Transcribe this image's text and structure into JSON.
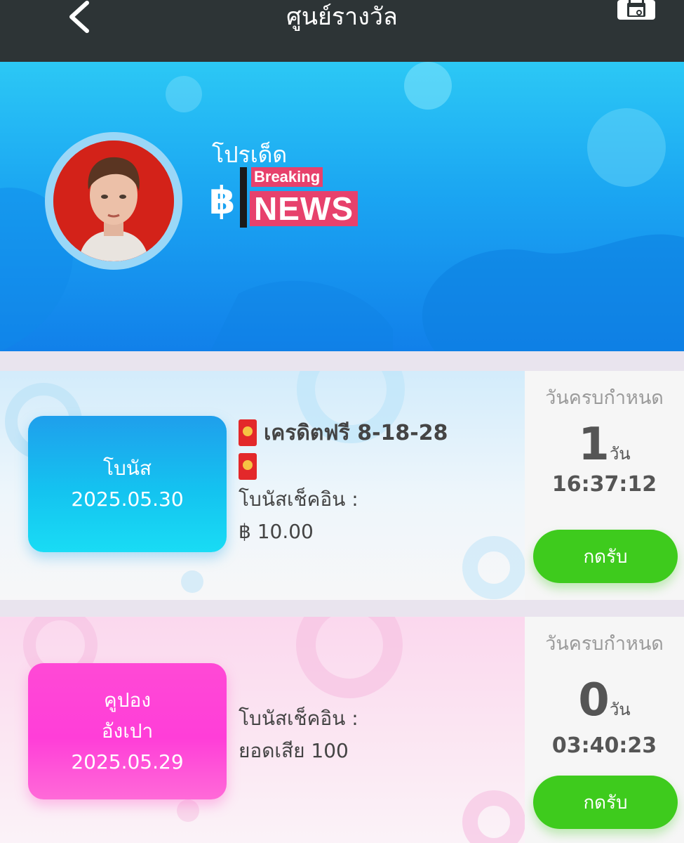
{
  "header": {
    "title": "ศูนย์รางวัล",
    "back_icon": "chevron-left-icon",
    "calendar_icon": "calendar-ticket-icon"
  },
  "banner": {
    "promo_label": "โปรเด็ด",
    "currency_symbol": "฿",
    "logo_small": "Breaking",
    "logo_big": "NEWS"
  },
  "rewards": [
    {
      "badge_lines": [
        "โบนัส",
        "2025.05.30"
      ],
      "title": "เครดิตฟรี 8-18-28",
      "detail_lines": [
        "โบนัสเช็คอิน :",
        "฿ 10.00"
      ],
      "due_label": "วันครบกำหนด",
      "days": "1",
      "days_unit": "วัน",
      "time": "16:37:12",
      "button": "กดรับ"
    },
    {
      "badge_lines": [
        "คูปอง",
        "อังเปา",
        "2025.05.29"
      ],
      "detail_lines": [
        "โบนัสเช็คอิน :",
        "ยอดเสีย 100"
      ],
      "due_label": "วันครบกำหนด",
      "days": "0",
      "days_unit": "วัน",
      "time": "03:40:23",
      "button": "กดรับ"
    }
  ],
  "colors": {
    "topbar": "#2d3436",
    "banner_blue": "#1ba6f2",
    "badge_blue": "#14c3f0",
    "badge_pink": "#ff3ed8",
    "claim_green": "#3ecb1d"
  }
}
